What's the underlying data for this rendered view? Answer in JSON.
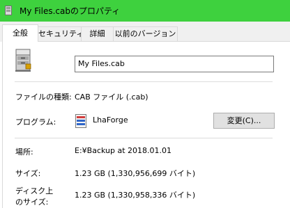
{
  "window": {
    "title": "My Files.cabのプロパティ"
  },
  "tabs": [
    {
      "label": "全般"
    },
    {
      "label": "セキュリティ"
    },
    {
      "label": "詳細"
    },
    {
      "label": "以前のバージョン"
    }
  ],
  "general": {
    "file_name": "My Files.cab",
    "file_type_label": "ファイルの種類:",
    "file_type_value": "CAB ファイル (.cab)",
    "program_label": "プログラム:",
    "program_name": "LhaForge",
    "change_button": "変更(C)...",
    "location_label": "場所:",
    "location_value": "E:¥Backup at 2018.01.01",
    "size_label": "サイズ:",
    "size_value": "1.23 GB (1,330,956,699 バイト)",
    "disk_size_label_line1": "ディスク上",
    "disk_size_label_line2": "のサイズ:",
    "disk_size_value": "1.23 GB (1,330,958,336 バイト)"
  },
  "colors": {
    "titlebar": "#3ed13e",
    "tab_strip": "#f0f0f0",
    "button_bg": "#e1e1e1"
  },
  "icons": {
    "title": "cabinet-file-icon",
    "file": "cabinet-file-icon",
    "program": "lhaforge-app-icon"
  }
}
